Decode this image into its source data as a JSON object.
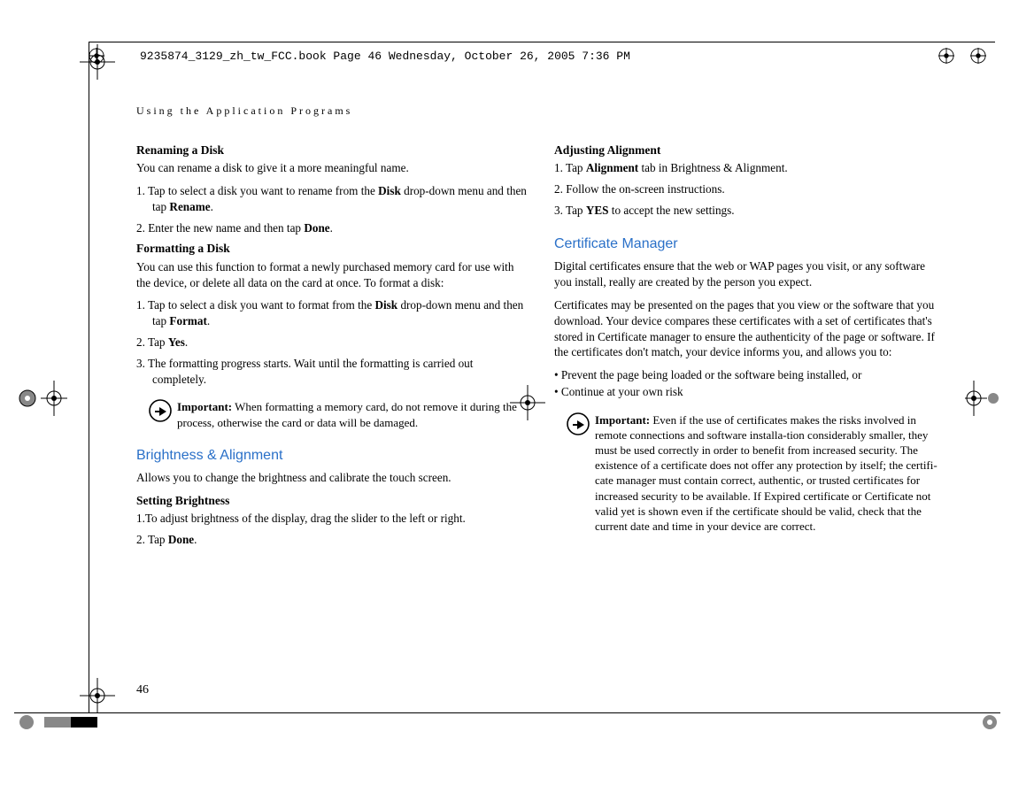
{
  "header_text": "9235874_3129_zh_tw_FCC.book  Page 46  Wednesday, October 26, 2005  7:36 PM",
  "running_head": "Using the Application Programs",
  "page_number": "46",
  "left": {
    "h1": "Renaming a Disk",
    "p1": "You can rename a disk to give it a more meaningful name.",
    "s1a": "1. Tap to select a disk you want to rename from the ",
    "s1b": "Disk",
    "s1c": " drop-down menu and then tap ",
    "s1d": "Rename",
    "s1e": ".",
    "s2a": "2. Enter the new name and then tap ",
    "s2b": "Done",
    "s2c": ".",
    "h2": "Formatting a Disk",
    "p2": "You can use this function to format a newly purchased memory card for use with the device, or delete all data on the card at once. To format a disk:",
    "s3a": "1. Tap to select a disk you want to format from the ",
    "s3b": "Disk",
    "s3c": " drop-down menu and then tap ",
    "s3d": "Format",
    "s3e": ".",
    "s4a": "2. Tap ",
    "s4b": "Yes",
    "s4c": ".",
    "s5": "3. The formatting progress starts. Wait until the formatting is carried out completely.",
    "note1_label": "Important:",
    "note1_text": " When formatting a memory card, do not remove it during the process, otherwise the card or data will be damaged.",
    "sec1": "Brightness & Alignment",
    "p3": "Allows you to change the brightness and calibrate the touch screen.",
    "h3": "Setting Brightness",
    "s6": "1.To adjust brightness of the display, drag the slider to the left or right.",
    "s7a": "2. Tap ",
    "s7b": "Done",
    "s7c": "."
  },
  "right": {
    "h1": "Adjusting Alignment",
    "s1a": "1. Tap ",
    "s1b": "Alignment",
    "s1c": " tab in Brightness & Alignment.",
    "s2": "2. Follow the on-screen instructions.",
    "s3a": "3. Tap ",
    "s3b": "YES",
    "s3c": " to accept the new settings.",
    "sec1": "Certificate Manager",
    "p1": "Digital certificates ensure that the web or WAP pages you visit, or any software you install, really are created by the person you expect.",
    "p2": "Certificates may be presented on the pages that you view or the software that you download. Your device compares these certificates with a set of certificates that's stored in Certificate manager to ensure the authenticity of the page or software. If the certificates don't match, your device informs you, and allows you to:",
    "b1": "• Prevent the page being loaded or the software being installed, or",
    "b2": "• Continue at your own risk",
    "note_label": "Important:",
    "note_text": " Even if the use of certificates makes the risks involved in remote connections and software installa-tion considerably smaller, they must be used correctly in order to benefit from increased security. The existence of a certificate does not offer any protection by itself; the certifi-cate manager must contain correct, authentic, or trusted certificates for increased security to be available. If Expired certificate or Certificate not valid yet is shown even if the certificate should be valid, check that the current date and time in your device are correct."
  }
}
